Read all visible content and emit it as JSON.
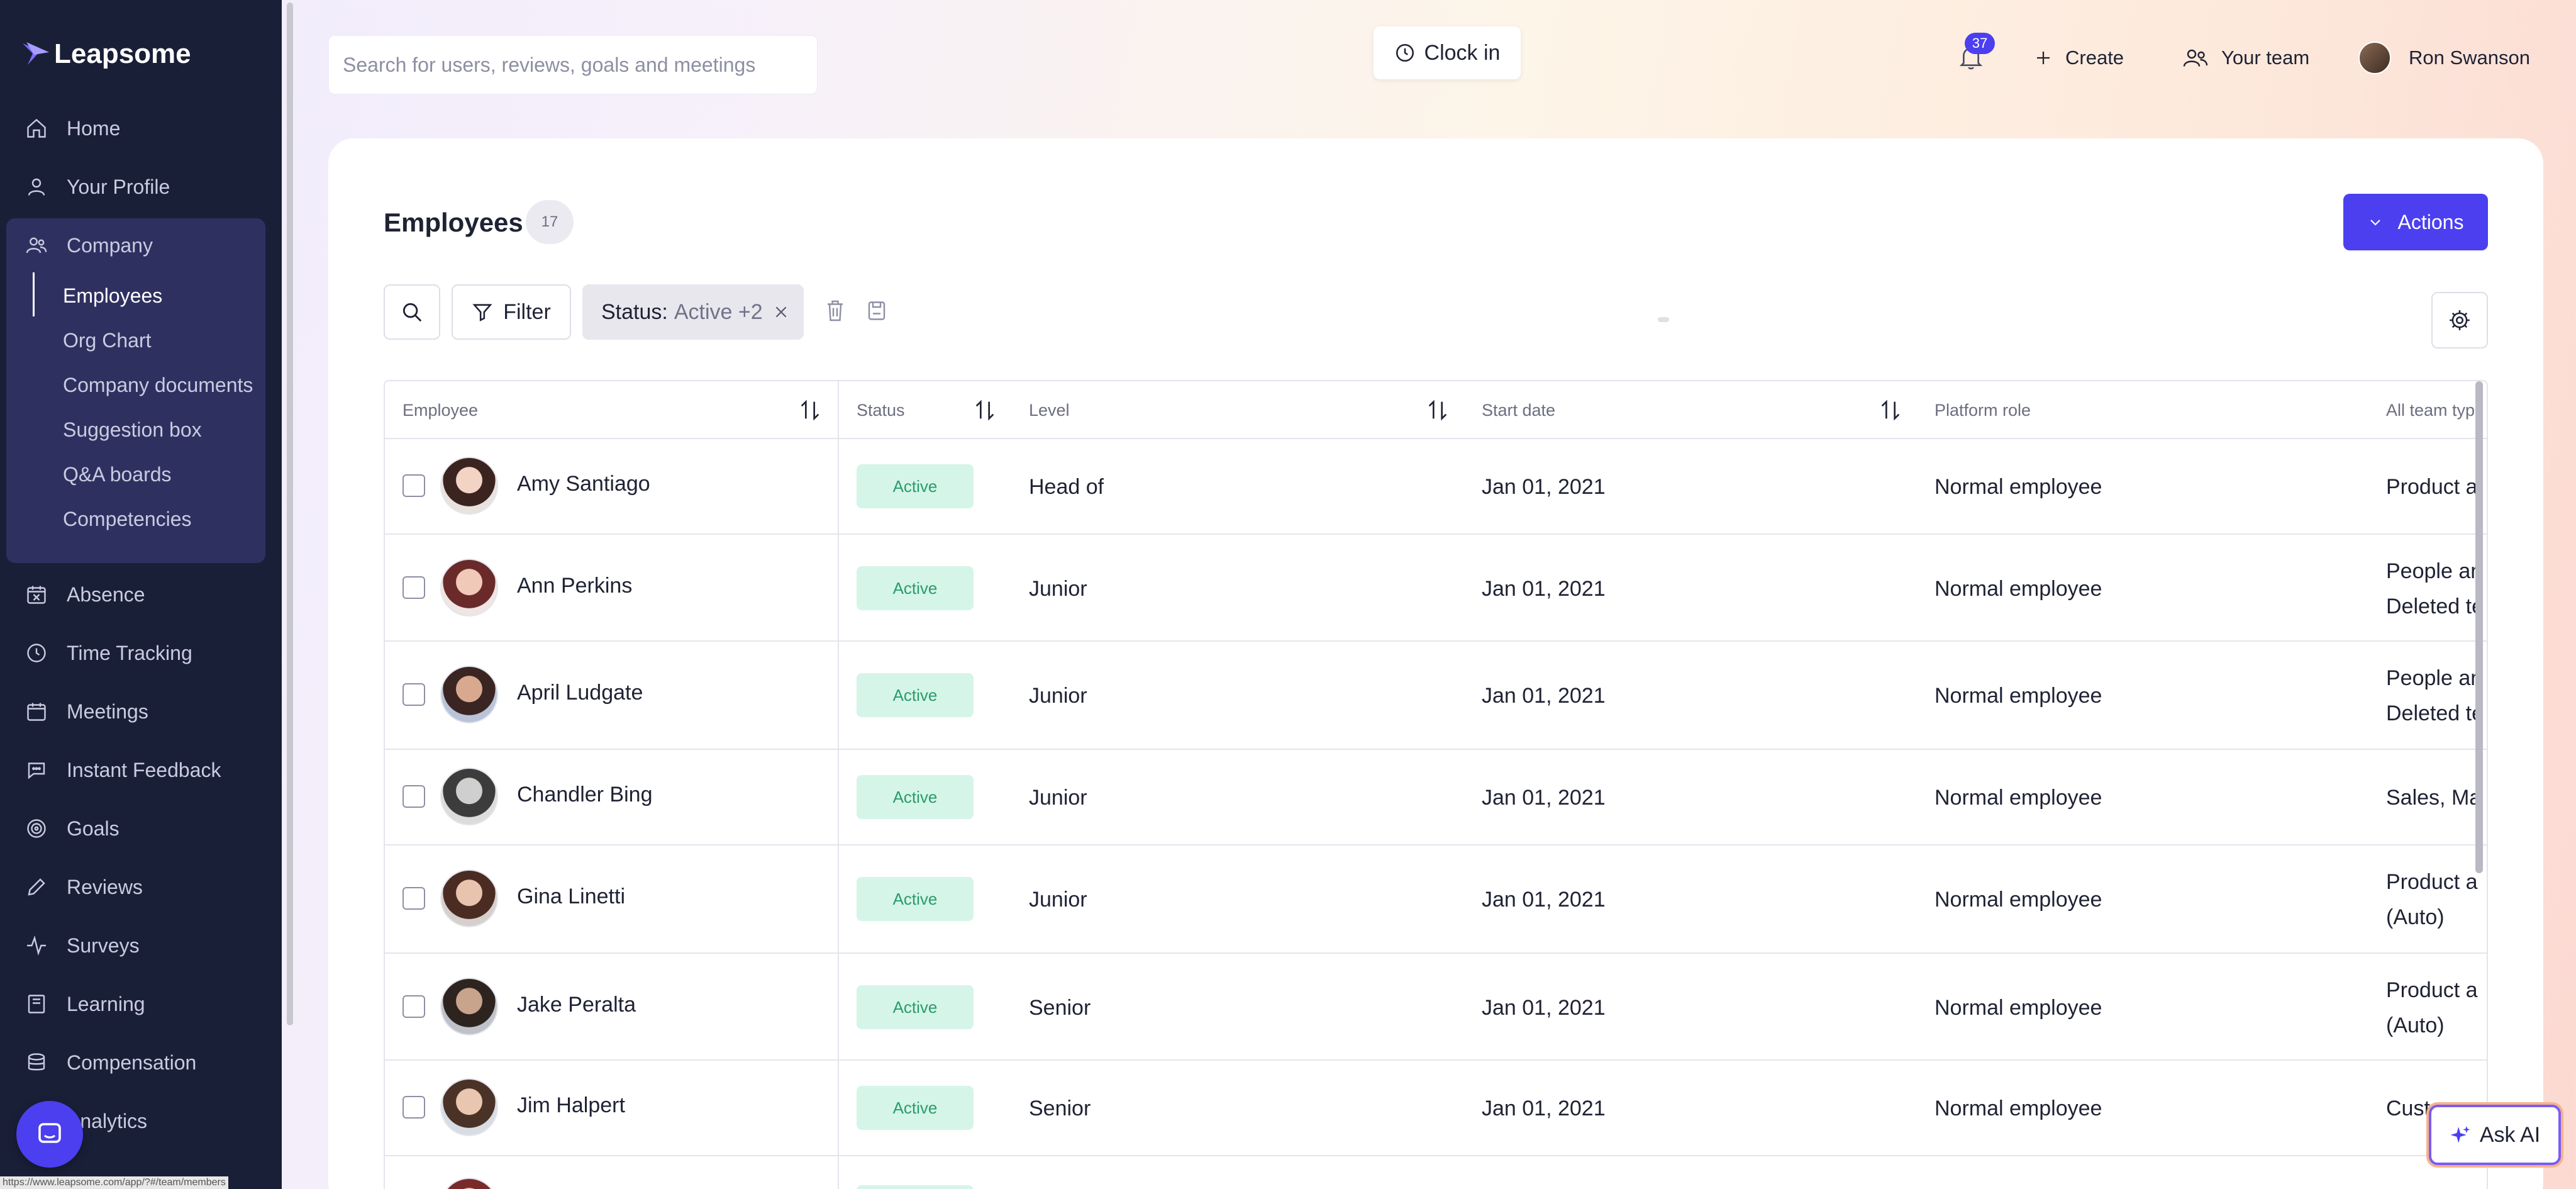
{
  "app": {
    "brand": "Leapsome"
  },
  "sidebar": {
    "items": [
      {
        "label": "Home",
        "icon": "home-icon"
      },
      {
        "label": "Your Profile",
        "icon": "user-icon"
      },
      {
        "label": "Company",
        "icon": "users-icon"
      },
      {
        "label": "Absence",
        "icon": "calendar-x-icon"
      },
      {
        "label": "Time Tracking",
        "icon": "clock-icon"
      },
      {
        "label": "Meetings",
        "icon": "calendar-icon"
      },
      {
        "label": "Instant Feedback",
        "icon": "chat-icon"
      },
      {
        "label": "Goals",
        "icon": "target-icon"
      },
      {
        "label": "Reviews",
        "icon": "pencil-icon"
      },
      {
        "label": "Surveys",
        "icon": "pulse-icon"
      },
      {
        "label": "Learning",
        "icon": "book-icon"
      },
      {
        "label": "Compensation",
        "icon": "coins-icon"
      },
      {
        "label": "Analytics",
        "icon": "chart-icon"
      }
    ],
    "company_sub": [
      {
        "label": "Employees",
        "active": true
      },
      {
        "label": "Org Chart"
      },
      {
        "label": "Company documents"
      },
      {
        "label": "Suggestion box"
      },
      {
        "label": "Q&A boards"
      },
      {
        "label": "Competencies"
      }
    ],
    "status_url": "https://www.leapsome.com/app/?#/team/members"
  },
  "topbar": {
    "search_placeholder": "Search for users, reviews, goals and meetings",
    "clock_in": "Clock in",
    "notification_count": "37",
    "create": "Create",
    "your_team": "Your team",
    "user_name": "Ron Swanson"
  },
  "main": {
    "title": "Employees",
    "count": "17",
    "actions": "Actions",
    "filter": "Filter",
    "status_filter_label": "Status:",
    "status_filter_value": "Active +2"
  },
  "table": {
    "columns": [
      "Employee",
      "Status",
      "Level",
      "Start date",
      "Platform role",
      "All team typ"
    ],
    "rows": [
      {
        "name": "Amy Santiago",
        "status": "Active",
        "level": "Head of",
        "start": "Jan 01, 2021",
        "role": "Normal employee",
        "teams": [
          "Product a"
        ]
      },
      {
        "name": "Ann Perkins",
        "status": "Active",
        "level": "Junior",
        "start": "Jan 01, 2021",
        "role": "Normal employee",
        "teams": [
          "People an",
          "Deleted te"
        ]
      },
      {
        "name": "April Ludgate",
        "status": "Active",
        "level": "Junior",
        "start": "Jan 01, 2021",
        "role": "Normal employee",
        "teams": [
          "People an",
          "Deleted te"
        ]
      },
      {
        "name": "Chandler Bing",
        "status": "Active",
        "level": "Junior",
        "start": "Jan 01, 2021",
        "role": "Normal employee",
        "teams": [
          "Sales, Ma"
        ]
      },
      {
        "name": "Gina Linetti",
        "status": "Active",
        "level": "Junior",
        "start": "Jan 01, 2021",
        "role": "Normal employee",
        "teams": [
          "Product a",
          "(Auto)"
        ]
      },
      {
        "name": "Jake Peralta",
        "status": "Active",
        "level": "Senior",
        "start": "Jan 01, 2021",
        "role": "Normal employee",
        "teams": [
          "Product a",
          "(Auto)"
        ]
      },
      {
        "name": "Jim Halpert",
        "status": "Active",
        "level": "Senior",
        "start": "Jan 01, 2021",
        "role": "Normal employee",
        "teams": [
          "Cust"
        ]
      }
    ]
  },
  "ask_ai": "Ask AI",
  "colors": {
    "accent": "#4b3ff0",
    "sidebar": "#1a1f38",
    "active_pill_bg": "#d5f5e8",
    "active_pill_text": "#2a9c6a"
  }
}
